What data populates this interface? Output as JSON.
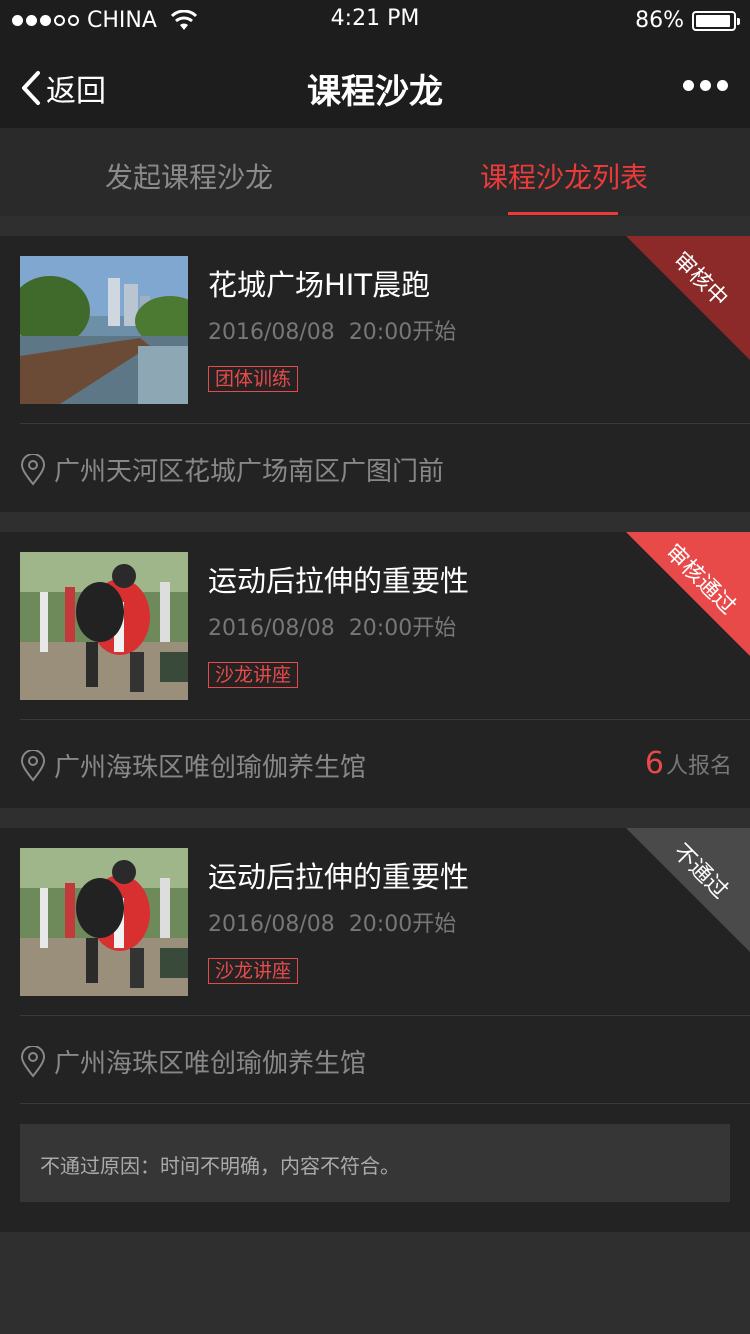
{
  "status_bar": {
    "carrier": "CHINA",
    "time": "4:21 PM",
    "battery": "86%",
    "battery_level": 0.86
  },
  "nav": {
    "back_label": "返回",
    "title": "课程沙龙",
    "more_icon": "more-icon"
  },
  "tabs": [
    {
      "label": "发起课程沙龙",
      "active": false
    },
    {
      "label": "课程沙龙列表",
      "active": true
    }
  ],
  "colors": {
    "accent": "#ea3a3a",
    "ribbon_pending": "#8c2a2a",
    "ribbon_approved": "#e84a4a",
    "ribbon_rejected": "#4a4a4a"
  },
  "items": [
    {
      "title": "花城广场HIT晨跑",
      "date": "2016/08/08",
      "time": "20:00开始",
      "tag": "团体训练",
      "status": "审核中",
      "location": "广州天河区花城广场南区广图门前"
    },
    {
      "title": "运动后拉伸的重要性",
      "date": "2016/08/08",
      "time": "20:00开始",
      "tag": "沙龙讲座",
      "status": "审核通过",
      "location": "广州海珠区唯创瑜伽养生馆",
      "signup_count": "6",
      "signup_suffix": "人报名"
    },
    {
      "title": "运动后拉伸的重要性",
      "date": "2016/08/08",
      "time": "20:00开始",
      "tag": "沙龙讲座",
      "status": "不通过",
      "location": "广州海珠区唯创瑜伽养生馆",
      "reason": "不通过原因：时间不明确，内容不符合。"
    }
  ]
}
